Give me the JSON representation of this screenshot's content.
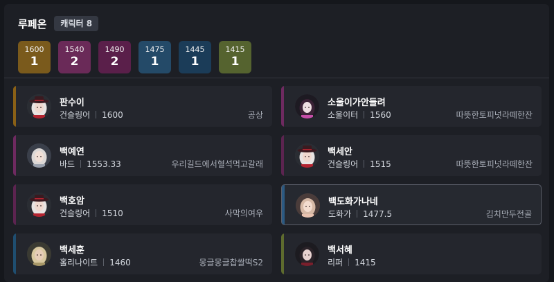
{
  "header": {
    "server_name": "루페온",
    "char_count_label": "캐릭터 8"
  },
  "level_badges": [
    {
      "level": "1600",
      "count": "1",
      "color": "#7a5a1c"
    },
    {
      "level": "1540",
      "count": "2",
      "color": "#6a2a58"
    },
    {
      "level": "1490",
      "count": "2",
      "color": "#5a1f4a"
    },
    {
      "level": "1475",
      "count": "1",
      "color": "#244a68"
    },
    {
      "level": "1445",
      "count": "1",
      "color": "#1b3c58"
    },
    {
      "level": "1415",
      "count": "1",
      "color": "#55632f"
    }
  ],
  "characters": [
    {
      "name": "판수이",
      "class": "건슬링어",
      "item_level": "1600",
      "guild": "공상",
      "accent": "#8a6016",
      "avatar": "gunslinger"
    },
    {
      "name": "소울이가안들려",
      "class": "소울이터",
      "item_level": "1560",
      "guild": "따뜻한토피넛라떼한잔",
      "accent": "#6e2a60",
      "avatar": "souleater"
    },
    {
      "name": "백예연",
      "class": "바드",
      "item_level": "1553.33",
      "guild": "우리길드에서혈석먹고갈래",
      "accent": "#6e2a60",
      "avatar": "bard"
    },
    {
      "name": "백세안",
      "class": "건슬링어",
      "item_level": "1515",
      "guild": "따뜻한토피넛라떼한잔",
      "accent": "#5c2450",
      "avatar": "gunslinger"
    },
    {
      "name": "백호암",
      "class": "건슬링어",
      "item_level": "1510",
      "guild": "사막의여우",
      "accent": "#5c2450",
      "avatar": "gunslinger"
    },
    {
      "name": "백도화가나네",
      "class": "도화가",
      "item_level": "1477.5",
      "guild": "김치만두전골",
      "accent": "#2c5a82",
      "avatar": "artist",
      "selected": true
    },
    {
      "name": "백세훈",
      "class": "홀리나이트",
      "item_level": "1460",
      "guild": "몽글몽글찹쌀떡S2",
      "accent": "#1f4e70",
      "avatar": "paladin"
    },
    {
      "name": "백서혜",
      "class": "리퍼",
      "item_level": "1415",
      "guild": "",
      "accent": "#5e6b2e",
      "avatar": "reaper"
    }
  ]
}
